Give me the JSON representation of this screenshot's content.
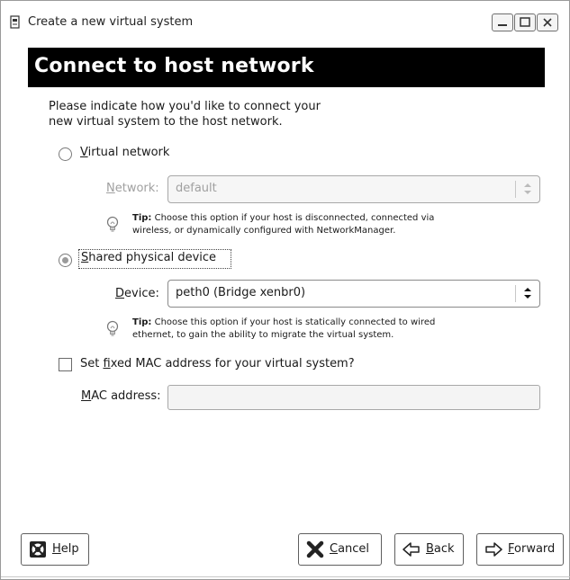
{
  "window": {
    "title": "Create a new virtual system",
    "controls": [
      "minimize-icon",
      "maximize-icon",
      "close-icon"
    ]
  },
  "header": {
    "title": "Connect to host network"
  },
  "intro": {
    "line1": "Please indicate how you'd like to connect your",
    "line2": "new virtual system to the host network."
  },
  "virtual_network": {
    "mnemonic": "V",
    "label_rest": "irtual network",
    "selected": false,
    "network_label_mnemonic": "N",
    "network_label_rest": "etwork:",
    "network_value": "default",
    "tip_bold": "Tip:",
    "tip_line1": " Choose this option if your host is disconnected, connected via",
    "tip_line2": "wireless, or dynamically configured with NetworkManager."
  },
  "shared_device": {
    "mnemonic": "S",
    "label_rest": "hared physical device",
    "selected": true,
    "device_label_mnemonic": "D",
    "device_label_rest": "evice:",
    "device_value": "peth0 (Bridge xenbr0)",
    "tip_bold": "Tip:",
    "tip_line1": " Choose this option if your host is statically connected to wired",
    "tip_line2": "ethernet, to gain the ability to migrate the virtual system."
  },
  "mac": {
    "checkbox_pre": "Set ",
    "checkbox_mnemonic": "f",
    "checkbox_rest": "ixed MAC address for your virtual system?",
    "checked": false,
    "field_label_mnemonic": "M",
    "field_label_rest": "AC address:",
    "field_value": ""
  },
  "buttons": {
    "help": {
      "mnemonic": "H",
      "rest": "elp",
      "icon": "help-lifebuoy-icon"
    },
    "cancel": {
      "mnemonic": "C",
      "rest": "ancel",
      "icon": "cancel-x-icon"
    },
    "back": {
      "mnemonic": "B",
      "rest": "ack",
      "icon": "back-arrow-icon"
    },
    "forward": {
      "mnemonic": "F",
      "rest": "orward",
      "icon": "forward-arrow-icon"
    }
  }
}
